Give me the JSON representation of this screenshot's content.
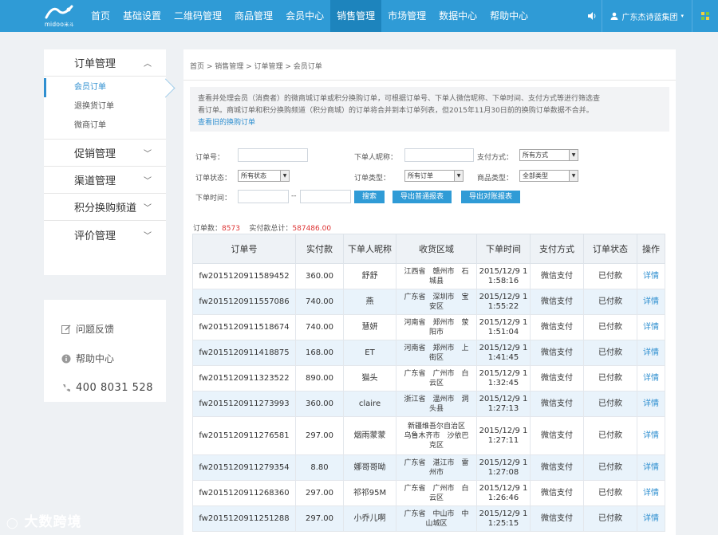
{
  "brand": {
    "name": "midoo",
    "suffix": "米斗"
  },
  "nav": [
    "首页",
    "基础设置",
    "二维码管理",
    "商品管理",
    "会员中心",
    "销售管理",
    "市场管理",
    "数据中心",
    "帮助中心"
  ],
  "nav_active": 5,
  "user": {
    "name": "广东杰诗蓝集团"
  },
  "sidebar": {
    "groups": [
      {
        "label": "订单管理",
        "expanded": true,
        "items": [
          "会员订单",
          "退换货订单",
          "微商订单"
        ],
        "active_item": 0
      },
      {
        "label": "促销管理"
      },
      {
        "label": "渠道管理"
      },
      {
        "label": "积分换购频道"
      },
      {
        "label": "评价管理"
      }
    ],
    "help": {
      "feedback": "问题反馈",
      "help_center": "帮助中心",
      "phone": "400 8031 528"
    }
  },
  "breadcrumb": "首页 > 销售管理 > 订单管理 > 会员订单",
  "notice": {
    "line1": "查看并处理会员（消费者）的微商城订单或积分换购订单，可根据订单号、下单人微信昵称、下单时间、支付方式等进行筛选查",
    "line2": "看订单。商城订单和积分换购频道（积分商城）的订单将合并到本订单列表，但2015年11月30日前的换购订单数据不合并。",
    "link": "查看旧的换购订单"
  },
  "filters": {
    "order_no_label": "订单号：",
    "nickname_label": "下单人昵称：",
    "pay_label": "支付方式：",
    "pay_value": "所有方式",
    "status_label": "订单状态：",
    "status_value": "所有状态",
    "type_label": "订单类型：",
    "type_value": "所有订单",
    "goods_type_label": "商品类型：",
    "goods_type_value": "全部类型",
    "time_label": "下单时间：",
    "time_sep": "--",
    "search_btn": "搜索",
    "export_normal_btn": "导出普通报表",
    "export_recon_btn": "导出对账报表"
  },
  "summary": {
    "count_label": "订单数：",
    "count": "8573",
    "total_label": "实付款总计：",
    "total": "587486.00"
  },
  "table": {
    "headers": [
      "订单号",
      "实付款",
      "下单人昵称",
      "收货区域",
      "下单时间",
      "支付方式",
      "订单状态",
      "操作"
    ],
    "rows": [
      {
        "no": "fw2015120911589452",
        "paid": "360.00",
        "nick": "舒舒",
        "area1": "江西省　赣州市　石",
        "area2": "城县",
        "date": "2015/12/9 1",
        "time": "1:58:16",
        "pay": "微信支付",
        "status": "已付款",
        "op": "详情"
      },
      {
        "no": "fw2015120911557086",
        "paid": "740.00",
        "nick": "燕",
        "area1": "广东省　深圳市　宝",
        "area2": "安区",
        "date": "2015/12/9 1",
        "time": "1:55:22",
        "pay": "微信支付",
        "status": "已付款",
        "op": "详情"
      },
      {
        "no": "fw2015120911518674",
        "paid": "740.00",
        "nick": "慧妍",
        "area1": "河南省　郑州市　荥",
        "area2": "阳市",
        "date": "2015/12/9 1",
        "time": "1:51:04",
        "pay": "微信支付",
        "status": "已付款",
        "op": "详情"
      },
      {
        "no": "fw2015120911418875",
        "paid": "168.00",
        "nick": "ET",
        "area1": "河南省　郑州市　上",
        "area2": "街区",
        "date": "2015/12/9 1",
        "time": "1:41:45",
        "pay": "微信支付",
        "status": "已付款",
        "op": "详情"
      },
      {
        "no": "fw2015120911323522",
        "paid": "890.00",
        "nick": "猫头",
        "area1": "广东省　广州市　白",
        "area2": "云区",
        "date": "2015/12/9 1",
        "time": "1:32:45",
        "pay": "微信支付",
        "status": "已付款",
        "op": "详情"
      },
      {
        "no": "fw2015120911273993",
        "paid": "360.00",
        "nick": "claire",
        "area1": "浙江省　温州市　洞",
        "area2": "头县",
        "date": "2015/12/9 1",
        "time": "1:27:13",
        "pay": "微信支付",
        "status": "已付款",
        "op": "详情"
      },
      {
        "no": "fw2015120911276581",
        "paid": "297.00",
        "nick": "烟雨蒙蒙",
        "area1": "新疆维吾尔自治区",
        "area2": "乌鲁木齐市　沙依巴",
        "area3": "克区",
        "date": "2015/12/9 1",
        "time": "1:27:11",
        "pay": "微信支付",
        "status": "已付款",
        "op": "详情"
      },
      {
        "no": "fw2015120911279354",
        "paid": "8.80",
        "nick": "娜哥哥呦",
        "area1": "广东省　湛江市　雷",
        "area2": "州市",
        "date": "2015/12/9 1",
        "time": "1:27:08",
        "pay": "微信支付",
        "status": "已付款",
        "op": "详情"
      },
      {
        "no": "fw2015120911268360",
        "paid": "297.00",
        "nick": "祁祁95M",
        "area1": "广东省　广州市　白",
        "area2": "云区",
        "date": "2015/12/9 1",
        "time": "1:26:46",
        "pay": "微信支付",
        "status": "已付款",
        "op": "详情"
      },
      {
        "no": "fw2015120911251288",
        "paid": "297.00",
        "nick": "小乔儿啊",
        "area1": "广东省　中山市　中",
        "area2": "山城区",
        "date": "2015/12/9 1",
        "time": "1:25:15",
        "pay": "微信支付",
        "status": "已付款",
        "op": "详情"
      }
    ]
  },
  "watermark": "大数跨境"
}
